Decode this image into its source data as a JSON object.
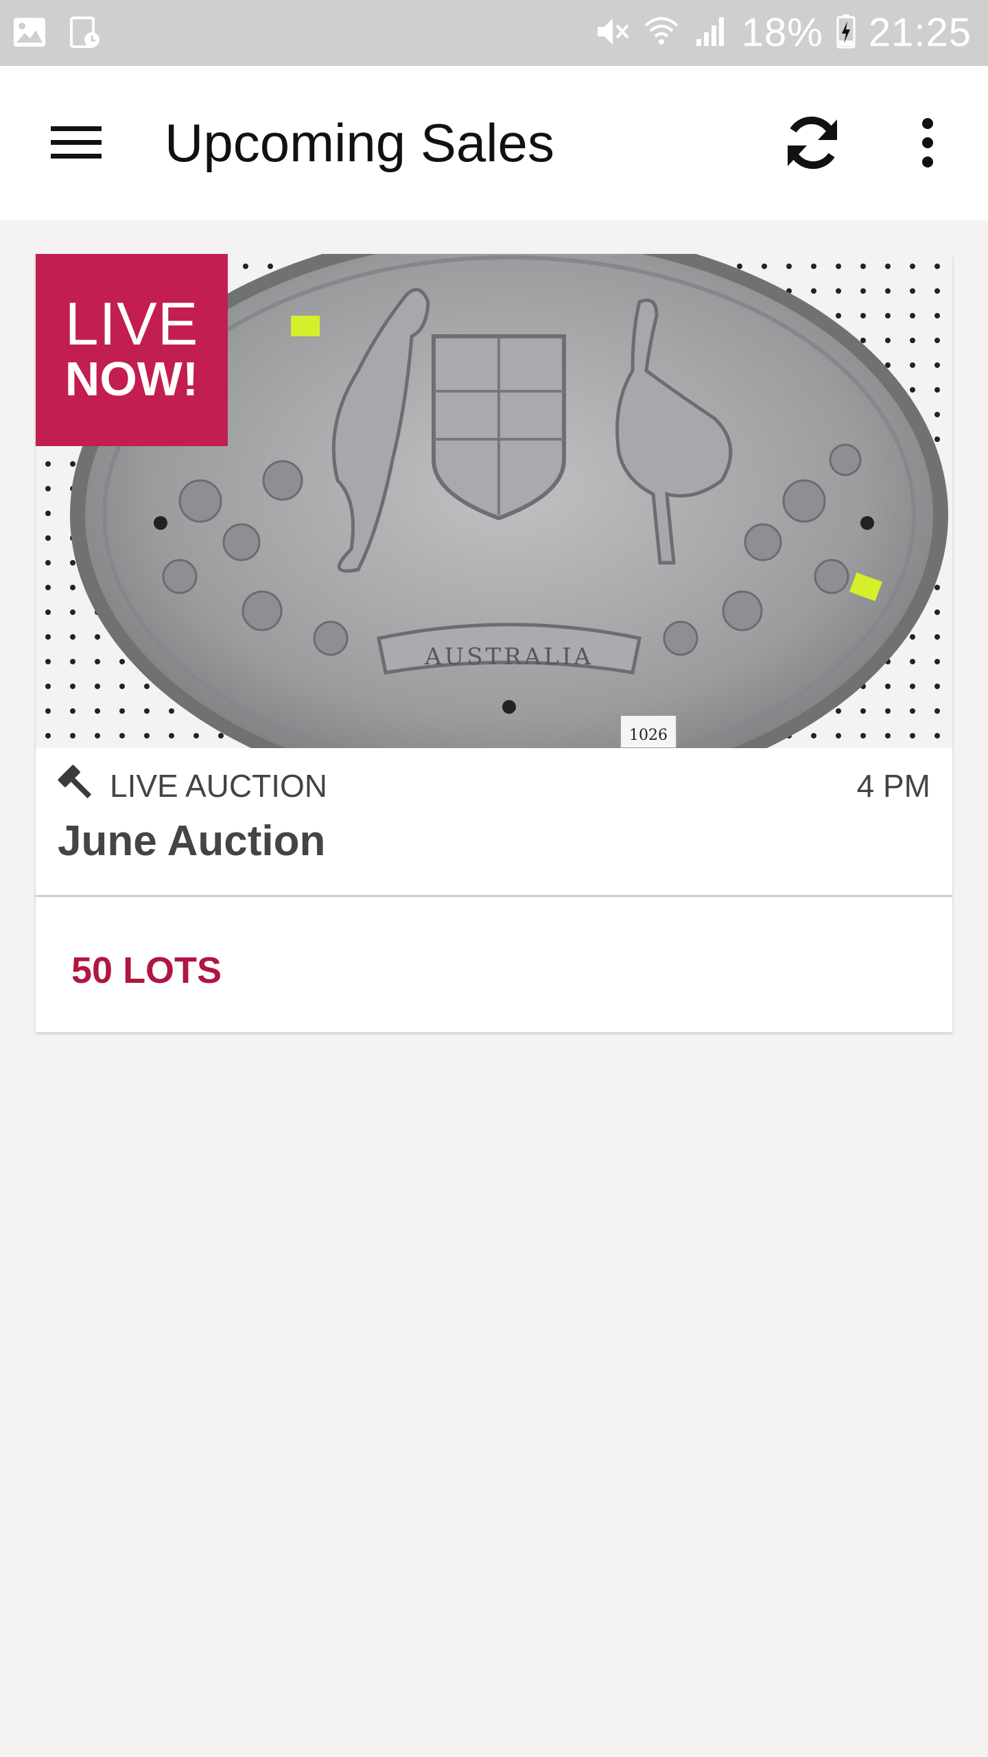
{
  "status_bar": {
    "battery_percent": "18%",
    "time": "21:25",
    "icons": [
      "image-icon",
      "calendar-clock-icon",
      "mute-icon",
      "wifi-icon",
      "signal-icon",
      "battery-charging-icon"
    ]
  },
  "toolbar": {
    "title": "Upcoming Sales",
    "menu_icon": "hamburger-menu-icon",
    "refresh_icon": "refresh-icon",
    "more_icon": "more-vertical-icon"
  },
  "sale": {
    "badge_line1": "LIVE",
    "badge_line2": "NOW!",
    "type_label": "LIVE AUCTION",
    "time": "4 PM",
    "name": "June Auction",
    "lots": "50 LOTS",
    "type_icon": "gavel-icon",
    "image_subject": "AUSTRALIA",
    "lot_tag": "1026"
  },
  "colors": {
    "accent": "#c21e50",
    "lots_text": "#b0163f",
    "status_bar": "#cfcfcf",
    "background": "#f4f3f1"
  }
}
